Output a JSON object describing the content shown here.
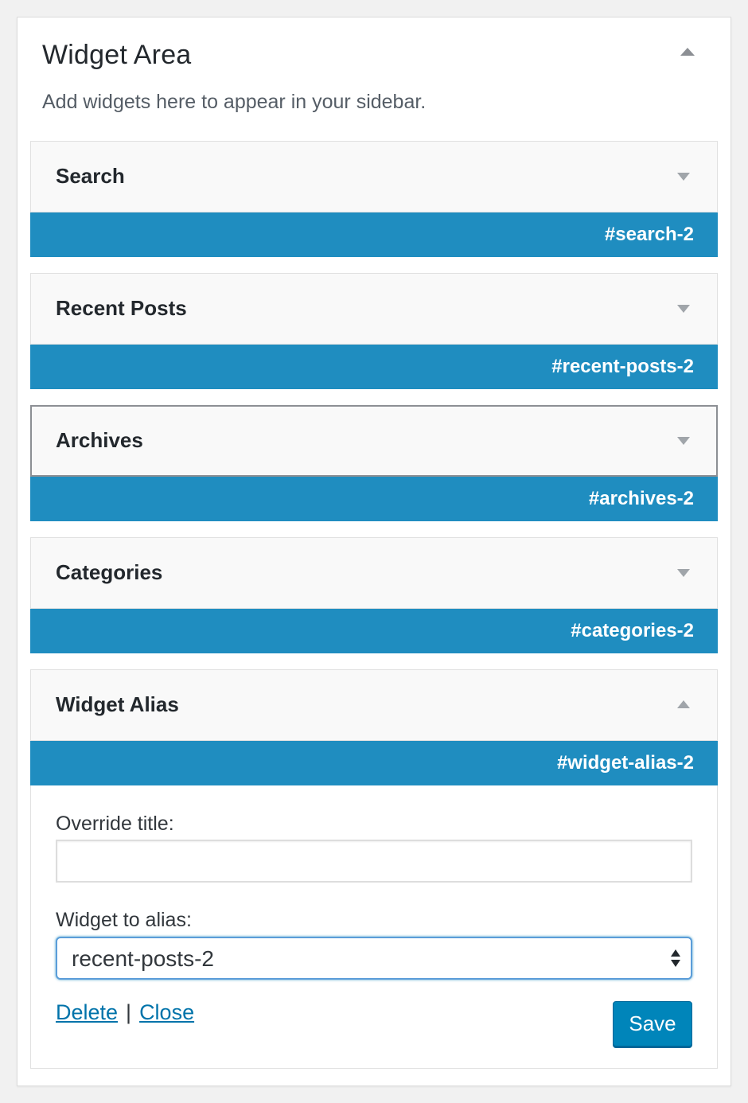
{
  "sidebar_area": {
    "title": "Widget Area",
    "description": "Add widgets here to appear in your sidebar."
  },
  "widgets": [
    {
      "title": "Search",
      "id": "#search-2",
      "expanded": false
    },
    {
      "title": "Recent Posts",
      "id": "#recent-posts-2",
      "expanded": false
    },
    {
      "title": "Archives",
      "id": "#archives-2",
      "expanded": false
    },
    {
      "title": "Categories",
      "id": "#categories-2",
      "expanded": false
    },
    {
      "title": "Widget Alias",
      "id": "#widget-alias-2",
      "expanded": true
    }
  ],
  "alias_form": {
    "override_title_label": "Override title:",
    "override_title_value": "",
    "widget_to_alias_label": "Widget to alias:",
    "widget_to_alias_value": "recent-posts-2",
    "delete_label": "Delete",
    "separator": "|",
    "close_label": "Close",
    "save_label": "Save"
  },
  "colors": {
    "id_bar": "#1f8dc0",
    "link": "#0073aa",
    "save_button": "#0085ba",
    "focus_border": "#5b9dd9"
  },
  "icons": {
    "area_toggle": "triangle-up-icon",
    "widget_toggle_collapsed": "triangle-down-icon",
    "widget_toggle_expanded": "triangle-up-icon",
    "select_arrows": "up-down-arrows-icon"
  }
}
